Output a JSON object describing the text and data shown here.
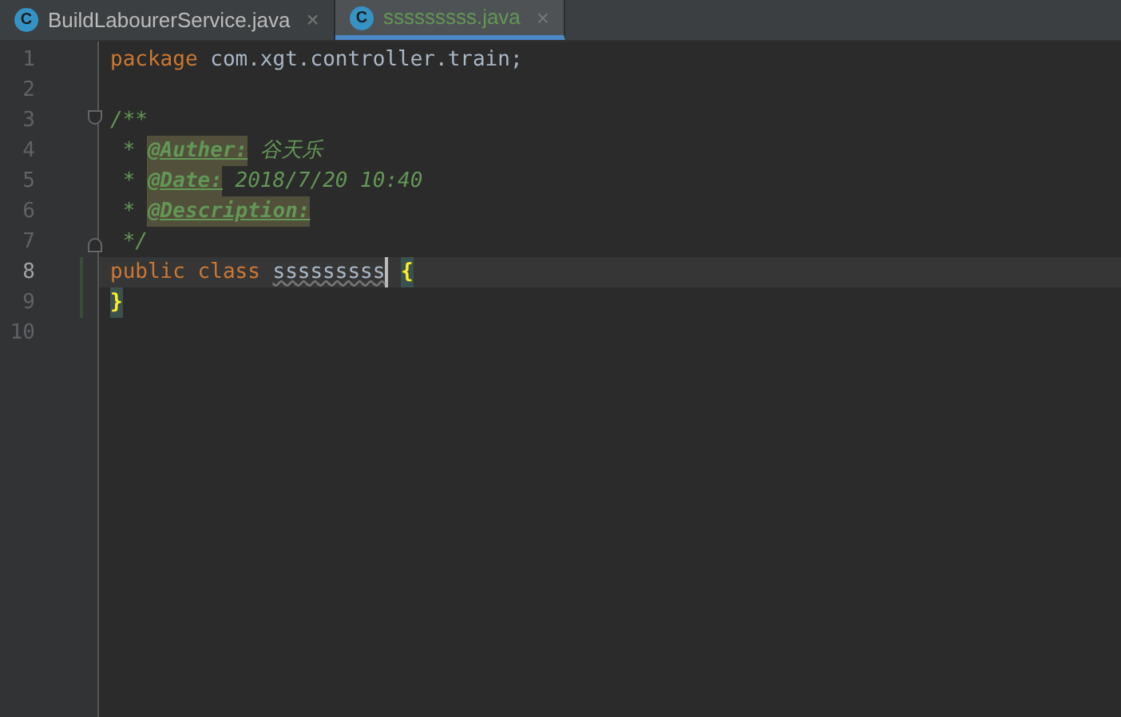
{
  "tabs": [
    {
      "label": "BuildLabourerService.java",
      "icon": "C",
      "close": "×",
      "selected": false
    },
    {
      "label": "sssssssss.java",
      "icon": "C",
      "close": "×",
      "selected": true
    }
  ],
  "lines": [
    {
      "number": "1",
      "current": false,
      "changed": false,
      "fold_start": false,
      "fold_end": false,
      "tokens": [
        {
          "kind": "keyword",
          "text": "package "
        },
        {
          "kind": "plain",
          "text": "com.xgt.controller.train;"
        }
      ]
    },
    {
      "number": "2",
      "current": false,
      "changed": false,
      "fold_start": false,
      "fold_end": false
    },
    {
      "number": "3",
      "current": false,
      "changed": false,
      "fold_start": true,
      "fold_end": false,
      "tokens": [
        {
          "kind": "comment",
          "text": "/**"
        }
      ]
    },
    {
      "number": "4",
      "current": false,
      "changed": false,
      "fold_start": false,
      "fold_end": false,
      "tokens": [
        {
          "kind": "comment",
          "text": " * "
        },
        {
          "kind": "tag",
          "text": "@Auther:"
        },
        {
          "kind": "comment",
          "text": " 谷天乐"
        }
      ]
    },
    {
      "number": "5",
      "current": false,
      "changed": false,
      "fold_start": false,
      "fold_end": false,
      "tokens": [
        {
          "kind": "comment",
          "text": " * "
        },
        {
          "kind": "tag",
          "text": "@Date:"
        },
        {
          "kind": "doc",
          "text": " 2018/7/20 10:40"
        }
      ]
    },
    {
      "number": "6",
      "current": false,
      "changed": false,
      "fold_start": false,
      "fold_end": false,
      "tokens": [
        {
          "kind": "comment",
          "text": " * "
        },
        {
          "kind": "tag",
          "text": "@Description:"
        }
      ]
    },
    {
      "number": "7",
      "current": false,
      "changed": false,
      "fold_start": false,
      "fold_end": true,
      "tokens": [
        {
          "kind": "comment",
          "text": " */"
        }
      ]
    },
    {
      "number": "8",
      "current": true,
      "changed": true,
      "fold_start": false,
      "fold_end": false,
      "tokens": [
        {
          "kind": "keyword",
          "text": "public class "
        },
        {
          "kind": "classname",
          "text": "sssssssss"
        },
        {
          "kind": "brace",
          "text": "{"
        }
      ]
    },
    {
      "number": "9",
      "current": false,
      "changed": true,
      "fold_start": false,
      "fold_end": false,
      "tokens": [
        {
          "kind": "brace",
          "text": "}"
        }
      ]
    },
    {
      "number": "10",
      "current": false,
      "changed": false,
      "fold_start": false,
      "fold_end": false
    }
  ]
}
